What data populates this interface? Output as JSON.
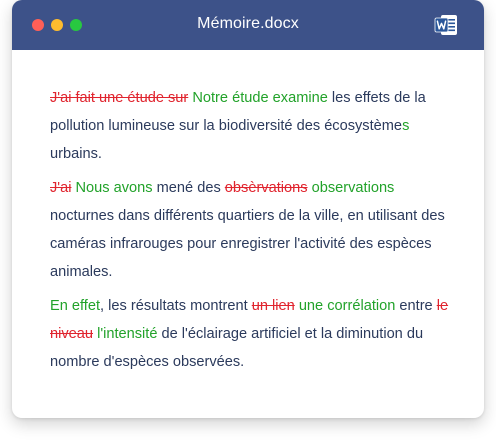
{
  "window": {
    "title": "Mémoire.docx",
    "app_icon": "word-icon",
    "colors": {
      "titlebar": "#3d5289",
      "close": "#ff5f57",
      "minimize": "#febc2e",
      "maximize": "#28c840",
      "deleted_text": "#e0242e",
      "inserted_text": "#22a22a",
      "body_text": "#2b3a5c"
    }
  },
  "document": {
    "paragraphs": [
      {
        "segments": [
          {
            "type": "del",
            "text": "J'ai fait une étude sur"
          },
          {
            "type": "normal",
            "text": " "
          },
          {
            "type": "ins",
            "text": "Notre étude examine"
          },
          {
            "type": "normal",
            "text": " les effets de la pollution lumineuse sur la biodiversité des écosystème"
          },
          {
            "type": "ins",
            "text": "s"
          },
          {
            "type": "normal",
            "text": " urbains."
          }
        ]
      },
      {
        "segments": [
          {
            "type": "del",
            "text": "J'ai"
          },
          {
            "type": "normal",
            "text": " "
          },
          {
            "type": "ins",
            "text": "Nous avons"
          },
          {
            "type": "normal",
            "text": " mené des "
          },
          {
            "type": "del",
            "text": "obsèrvations"
          },
          {
            "type": "normal",
            "text": " "
          },
          {
            "type": "ins",
            "text": "observations"
          },
          {
            "type": "normal",
            "text": " nocturnes dans différents quartiers de la ville, en utilisant des caméras infrarouges pour enregistrer l'activité des espèces animales."
          }
        ]
      },
      {
        "segments": [
          {
            "type": "ins",
            "text": "En effet"
          },
          {
            "type": "normal",
            "text": ", les résultats montrent "
          },
          {
            "type": "del",
            "text": "un lien"
          },
          {
            "type": "normal",
            "text": " "
          },
          {
            "type": "ins",
            "text": "une corrélation"
          },
          {
            "type": "normal",
            "text": " entre "
          },
          {
            "type": "del",
            "text": "le niveau"
          },
          {
            "type": "normal",
            "text": " "
          },
          {
            "type": "ins",
            "text": "l'intensité"
          },
          {
            "type": "normal",
            "text": " de l'éclairage artificiel et la diminution du nombre d'espèces observées."
          }
        ]
      }
    ]
  }
}
